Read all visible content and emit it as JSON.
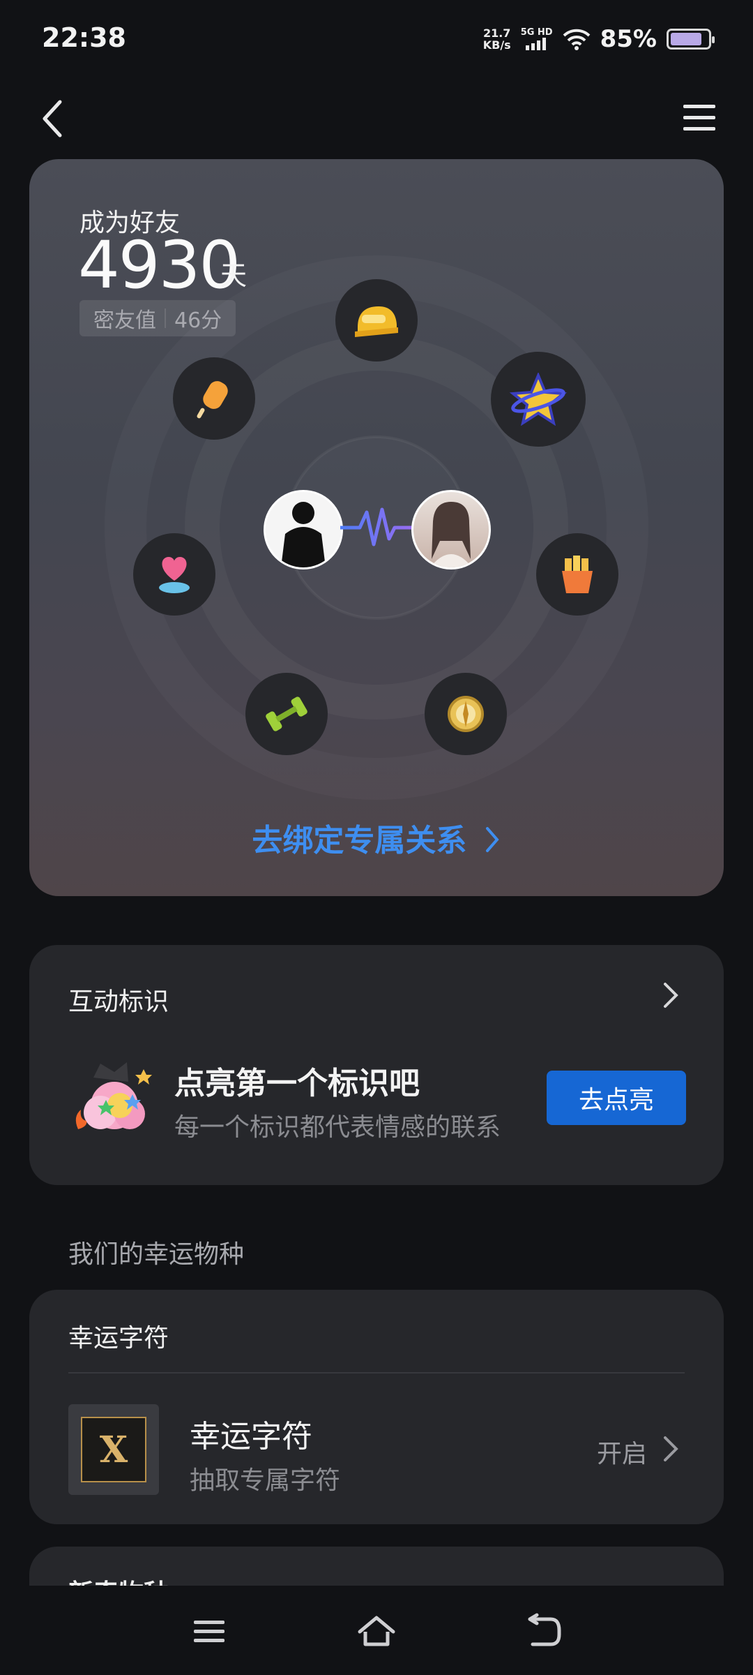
{
  "status": {
    "time": "22:38",
    "speed_value": "21.7",
    "speed_unit": "KB/s",
    "network": "5G HD",
    "battery": "85%"
  },
  "friend": {
    "label": "成为好友",
    "days": "4930",
    "unit": "天",
    "score_label": "密友值",
    "score_value": "46分",
    "bind_link": "去绑定专属关系"
  },
  "interaction": {
    "title": "互动标识",
    "headline": "点亮第一个标识吧",
    "subtitle": "每一个标识都代表情感的联系",
    "button": "去点亮"
  },
  "lucky": {
    "section_label": "我们的幸运物种",
    "card_title": "幸运字符",
    "item_name": "幸运字符",
    "item_sub": "抽取专属字符",
    "item_action": "开启",
    "item_glyph": "X"
  },
  "next_card": {
    "title": "新奇物种"
  },
  "colors": {
    "accent": "#1667d4",
    "link": "#3e8ef0",
    "background": "#111215",
    "card": "#26272b"
  },
  "icons": [
    "back-arrow-icon",
    "menu-icon",
    "helmet-icon",
    "star-planet-icon",
    "popsicle-icon",
    "heart-trophy-icon",
    "fries-icon",
    "dumbbell-icon",
    "compass-icon"
  ]
}
